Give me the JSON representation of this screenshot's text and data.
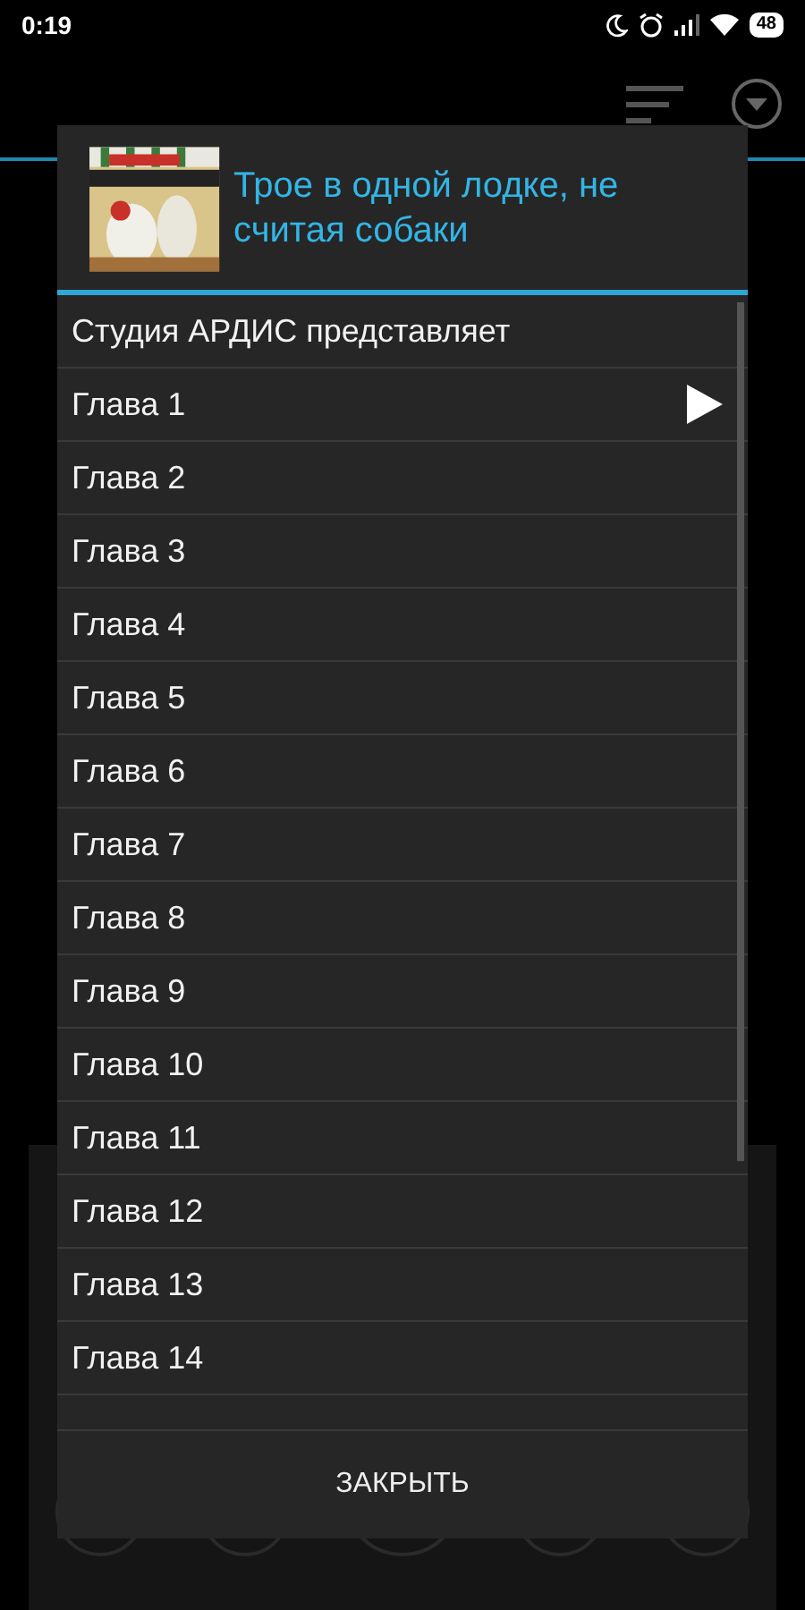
{
  "status_bar": {
    "time": "0:19",
    "battery": "48"
  },
  "dialog": {
    "title": "Трое в одной лодке, не считая собаки",
    "items": [
      {
        "label": "Студия АРДИС представляет",
        "playing": false
      },
      {
        "label": "Глава 1",
        "playing": true
      },
      {
        "label": "Глава 2",
        "playing": false
      },
      {
        "label": "Глава 3",
        "playing": false
      },
      {
        "label": "Глава 4",
        "playing": false
      },
      {
        "label": "Глава 5",
        "playing": false
      },
      {
        "label": "Глава 6",
        "playing": false
      },
      {
        "label": "Глава 7",
        "playing": false
      },
      {
        "label": "Глава 8",
        "playing": false
      },
      {
        "label": "Глава 9",
        "playing": false
      },
      {
        "label": "Глава 10",
        "playing": false
      },
      {
        "label": "Глава 11",
        "playing": false
      },
      {
        "label": "Глава 12",
        "playing": false
      },
      {
        "label": "Глава 13",
        "playing": false
      },
      {
        "label": "Глава 14",
        "playing": false
      }
    ],
    "close_button": "ЗАКРЫТЬ"
  }
}
